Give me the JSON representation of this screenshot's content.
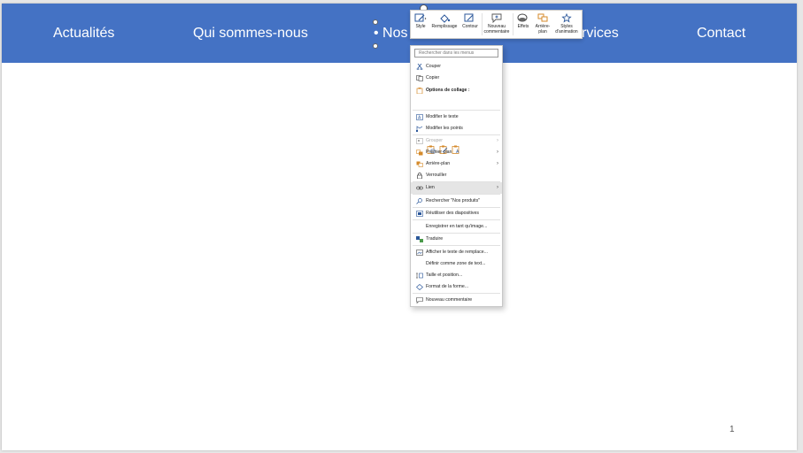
{
  "nav": {
    "items": [
      "Actualités",
      "Qui sommes-nous",
      "Nos ",
      "rvices",
      "Contact"
    ]
  },
  "page_number": "1",
  "mini_toolbar": {
    "buttons": [
      {
        "label": "Style",
        "icon": "style-icon"
      },
      {
        "label": "Remplissage",
        "icon": "fill-icon"
      },
      {
        "label": "Contour",
        "icon": "outline-icon"
      },
      {
        "label": "Nouveau\ncommentaire",
        "icon": "new-comment-icon"
      },
      {
        "label": "Effets",
        "icon": "effects-icon"
      },
      {
        "label": "Arrière-\nplan",
        "icon": "send-backward-icon"
      },
      {
        "label": "Styles\nd'animation",
        "icon": "animation-styles-icon"
      }
    ]
  },
  "context_menu": {
    "search_placeholder": "Rechercher dans les menus",
    "items": {
      "cut": "Couper",
      "copy": "Copier",
      "paste_options": "Options de collage :",
      "edit_text": "Modifier le texte",
      "edit_points": "Modifier les points",
      "group": "Grouper",
      "bring_front": "Premier plan",
      "send_back": "Arrière-plan",
      "lock": "Verrouiller",
      "link": "Lien",
      "search_for": "Rechercher \"Nos produits\"",
      "reuse_slides": "Réutiliser des diapositives",
      "save_as_image": "Enregistrer en tant qu'image...",
      "translate": "Traduire",
      "alt_text": "Afficher le texte de remplace...",
      "set_text_box": "Définir comme zone de text...",
      "size_position": "Taille et position...",
      "format_shape": "Format de la forme...",
      "new_comment": "Nouveau commentaire"
    }
  },
  "colors": {
    "nav_background": "#4472c4",
    "nav_text": "#ffffff",
    "icon_blue": "#2b579a",
    "icon_orange": "#d58a2a"
  }
}
